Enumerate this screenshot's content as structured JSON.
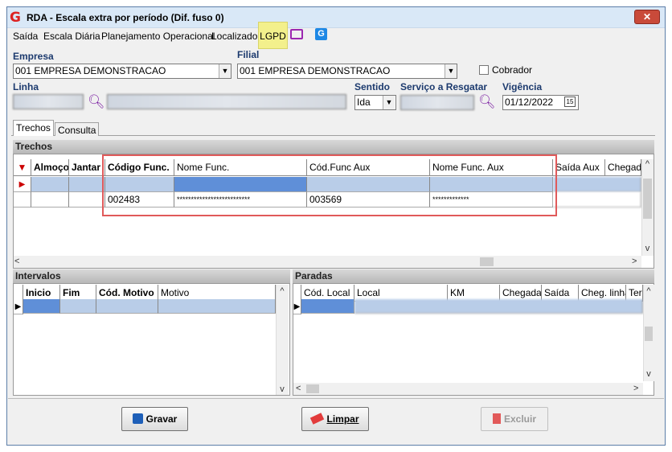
{
  "window": {
    "title": "RDA - Escala extra por período (Dif. fuso 0)",
    "close": "✕"
  },
  "menu": {
    "items": [
      "Saída",
      "Escala Diária",
      "Planejamento Operacional",
      "Localizador",
      "LGPD"
    ]
  },
  "form": {
    "empresa_label": "Empresa",
    "empresa_value": "001 EMPRESA DEMONSTRACAO",
    "filial_label": "Filial",
    "filial_value": "001 EMPRESA DEMONSTRACAO",
    "cobrador_label": "Cobrador",
    "linha_label": "Linha",
    "sentido_label": "Sentido",
    "sentido_value": "Ida",
    "servico_label": "Serviço a Resgatar",
    "vigencia_label": "Vigência",
    "vigencia_value": "01/12/2022",
    "vigencia_icon": "15"
  },
  "tabs": [
    "Trechos",
    "Consulta"
  ],
  "trechos": {
    "title": "Trechos",
    "columns": [
      "Almoço",
      "Jantar",
      "Código Func.",
      "Nome Func.",
      "Cód.Func Aux",
      "Nome Func. Aux",
      "Saída Aux",
      "Chegada"
    ],
    "row2": {
      "codigo": "002483",
      "nome": "**************************",
      "cod_aux": "003569",
      "nome_aux": "*************"
    }
  },
  "intervalos": {
    "title": "Intervalos",
    "columns": [
      "Inicio",
      "Fim",
      "Cód. Motivo",
      "Motivo"
    ]
  },
  "paradas": {
    "title": "Paradas",
    "columns": [
      "Cód. Local",
      "Local",
      "KM",
      "Chegada",
      "Saída",
      "Cheg. linha",
      "Ter"
    ]
  },
  "buttons": {
    "gravar": "Gravar",
    "limpar": "Limpar",
    "excluir": "Excluir"
  },
  "colors": {
    "highlight_box": "#e05a5a",
    "selection": "#5f8fd8",
    "lgpd_bg": "#f3f08c",
    "label": "#1c3a6e"
  }
}
